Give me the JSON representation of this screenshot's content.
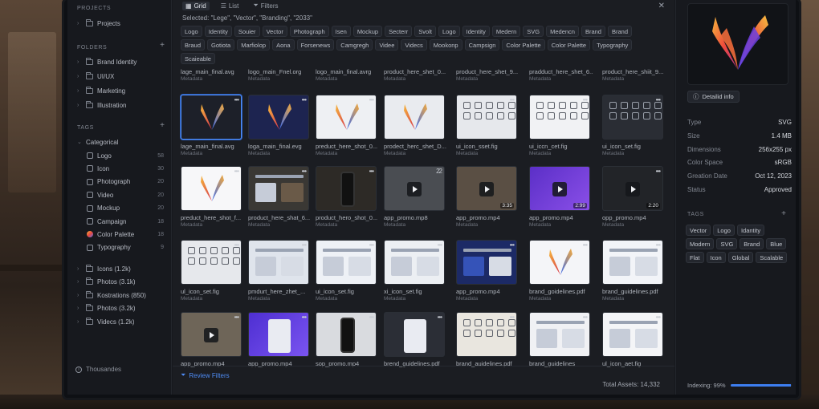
{
  "sidebar": {
    "projects_head": "PROJECTS",
    "projects_item": "Projects",
    "folders_head": "FOLDERS",
    "folders": [
      "Brand Identity",
      "UI/UX",
      "Marketing",
      "Illustration"
    ],
    "tags_head": "TAGS",
    "tags_group": "Categorical",
    "tags": [
      {
        "label": "Logo",
        "count": "58",
        "icon": "tag-icon"
      },
      {
        "label": "Icon",
        "count": "30",
        "icon": "tag-icon"
      },
      {
        "label": "Photograph",
        "count": "20",
        "icon": "tag-icon"
      },
      {
        "label": "Video",
        "count": "20",
        "icon": "tag-icon"
      },
      {
        "label": "Mockup",
        "count": "20",
        "icon": "tag-icon"
      },
      {
        "label": "Campaign",
        "count": "18",
        "icon": "tag-icon"
      },
      {
        "label": "Color Palette",
        "count": "18",
        "icon": "palette-icon"
      },
      {
        "label": "Typography",
        "count": "9",
        "icon": "tag-icon"
      }
    ],
    "collections": [
      "Icons (1.2k)",
      "Photos (3.1k)",
      "Kostrations (850)",
      "Photos (3.2k)",
      "Videcs (1.2k)"
    ],
    "footer": "Thousandes"
  },
  "toolbar": {
    "grid_label": "Grid",
    "list_label": "List",
    "filters_label": "Filters",
    "selected_text": "Selected: \"Lege\", \"Vector\", \"Branding\", \"2033\""
  },
  "chips": [
    "Logo",
    "Identity",
    "Souier",
    "Vector",
    "Photograph",
    "Isen",
    "Mockup",
    "Secterr",
    "Svolt",
    "Logo",
    "Identity",
    "Medern",
    "SVG",
    "Medencn",
    "Brand",
    "Brand",
    "Braud",
    "Gotiota",
    "Marfiolop",
    "Aona",
    "Forsenews",
    "Camgregh",
    "Videe",
    "Videcs",
    "Mookonp",
    "Campsign",
    "Color Palette",
    "Color Palette",
    "Typography",
    "Scaieable"
  ],
  "top_row": [
    {
      "name": "lage_main_final.avg",
      "meta": "Metadata"
    },
    {
      "name": "logo_main_Fnel.org",
      "meta": "Metadata"
    },
    {
      "name": "logo_main_final.avrg",
      "meta": "Metadata"
    },
    {
      "name": "product_here_shet_0...",
      "meta": "Metadata"
    },
    {
      "name": "product_here_shet_9...",
      "meta": "Metadata"
    },
    {
      "name": "pradduct_here_shet_6...",
      "meta": "Metadata"
    },
    {
      "name": "product_here_shiit_9...",
      "meta": "Metadata"
    }
  ],
  "rows": [
    [
      {
        "name": "lage_main_final.avg",
        "meta": "Metadata",
        "kind": "logo-dark",
        "more": true,
        "selected": true
      },
      {
        "name": "loga_main_final.evg",
        "meta": "Metadata",
        "kind": "logo-navy",
        "more": true
      },
      {
        "name": "preduct_here_shot_0...",
        "meta": "Metadata",
        "kind": "logo-light",
        "more": true
      },
      {
        "name": "prodect_herc_shet_D...",
        "meta": "Metadata",
        "kind": "product",
        "more": false
      },
      {
        "name": "ui_icon_sset.fig",
        "meta": "Metadata",
        "kind": "icons-light",
        "more": true
      },
      {
        "name": "ui_iccn_cet.fig",
        "meta": "Metadata",
        "kind": "icons-light2",
        "more": true
      },
      {
        "name": "ui_icon_set.fig",
        "meta": "Metadata",
        "kind": "icons-dark",
        "more": true
      }
    ],
    [
      {
        "name": "preduct_here_shot_f...",
        "meta": "Metadata",
        "kind": "logo-white",
        "more": true
      },
      {
        "name": "product_here_shat_6...",
        "meta": "Metadata",
        "kind": "web-dark",
        "more": true
      },
      {
        "name": "product_hero_shot_0...",
        "meta": "Metadata",
        "kind": "phone-dark",
        "more": true
      },
      {
        "name": "app_promo.mp8",
        "meta": "Metadata",
        "kind": "video-gray",
        "more": false,
        "badge": "22"
      },
      {
        "name": "app_promo.mp4",
        "meta": "Metadata",
        "kind": "video-street",
        "more": false,
        "duration": "3:35"
      },
      {
        "name": "app_promo.mp4",
        "meta": "Metadata",
        "kind": "video-purple",
        "more": false,
        "duration": "2:99"
      },
      {
        "name": "opp_promo.mp4",
        "meta": "Metadata",
        "kind": "video-dark",
        "more": true,
        "duration": "2:20"
      }
    ],
    [
      {
        "name": "ul_icon_set.fig",
        "meta": "Metadata",
        "kind": "icons-light",
        "more": true
      },
      {
        "name": "pmdurt_here_zhet_...",
        "meta": "Metadata",
        "kind": "web-mix",
        "more": true
      },
      {
        "name": "ui_icon_set.fig",
        "meta": "Metadata",
        "kind": "web-light",
        "more": true
      },
      {
        "name": "xi_icon_set.fig",
        "meta": "Metadata",
        "kind": "card-light",
        "more": true
      },
      {
        "name": "app_promo.mp4",
        "meta": "Metadata",
        "kind": "web-navy",
        "more": true
      },
      {
        "name": "brand_goidelines.pdf",
        "meta": "Metadata",
        "kind": "brand-doc",
        "more": true
      },
      {
        "name": "brand_guidelines.pdf",
        "meta": "Metadata",
        "kind": "web-light2",
        "more": true
      }
    ],
    [
      {
        "name": "app_promo.mp4",
        "meta": "",
        "kind": "video-photo",
        "more": true
      },
      {
        "name": "app_promo.mp4",
        "meta": "",
        "kind": "app-purple",
        "more": true
      },
      {
        "name": "sop_promo.mp4",
        "meta": "",
        "kind": "phone-gray",
        "more": true
      },
      {
        "name": "brend_guidelines.pdf",
        "meta": "",
        "kind": "people-dark",
        "more": true
      },
      {
        "name": "brand_auidelines.pdf",
        "meta": "",
        "kind": "icons-beige",
        "more": true
      },
      {
        "name": "brand_guidelines",
        "meta": "",
        "kind": "brand-illus",
        "more": true
      },
      {
        "name": "ul_icon_aet.fig",
        "meta": "",
        "kind": "web-light3",
        "more": true
      }
    ]
  ],
  "footer": {
    "review_label": "Review Filters",
    "total_label": "Total Assets: 14,332"
  },
  "details": {
    "detail_button": "Detailid info",
    "props": [
      {
        "k": "Type",
        "v": "SVG"
      },
      {
        "k": "Size",
        "v": "1.4 MB"
      },
      {
        "k": "Dimensions",
        "v": "256x255 px"
      },
      {
        "k": "Color Space",
        "v": "sRGB"
      },
      {
        "k": "Greation Date",
        "v": "Oct 12, 2023"
      },
      {
        "k": "Status",
        "v": "Approved"
      }
    ],
    "tags_head": "TAGS",
    "tags": [
      "Vector",
      "Logo",
      "Idantity",
      "Modern",
      "SVG",
      "Brand",
      "Blue",
      "Flat",
      "Icon",
      "Global",
      "Scalable"
    ],
    "indexing_label": "Indexing: 99%",
    "indexing_progress": 0.99
  },
  "colors": {
    "accent": "#3d7ef0",
    "logo_gradient": [
      "#f6b73c",
      "#ef4a3b",
      "#7d3bd6",
      "#3b6cf0"
    ]
  }
}
